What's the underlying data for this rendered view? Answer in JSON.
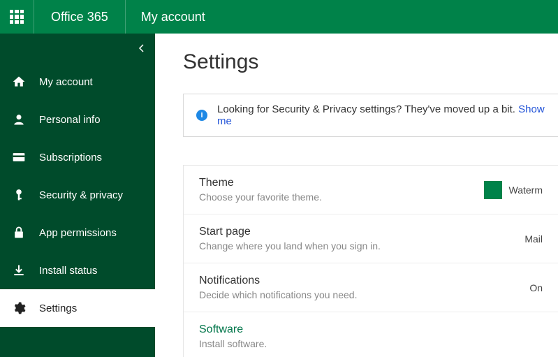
{
  "header": {
    "brand": "Office 365",
    "page": "My account"
  },
  "sidebar": {
    "items": [
      {
        "id": "my-account",
        "label": "My account"
      },
      {
        "id": "personal-info",
        "label": "Personal info"
      },
      {
        "id": "subscriptions",
        "label": "Subscriptions"
      },
      {
        "id": "security-privacy",
        "label": "Security & privacy"
      },
      {
        "id": "app-permissions",
        "label": "App permissions"
      },
      {
        "id": "install-status",
        "label": "Install status"
      },
      {
        "id": "settings",
        "label": "Settings"
      }
    ],
    "active": "settings"
  },
  "page_title": "Settings",
  "notice": {
    "text": "Looking for Security & Privacy settings? They've moved up a bit. ",
    "link_text": "Show me"
  },
  "settings": [
    {
      "title": "Theme",
      "desc": "Choose your favorite theme.",
      "value": "Waterm",
      "swatch": "#008249",
      "link": false
    },
    {
      "title": "Start page",
      "desc": "Change where you land when you sign in.",
      "value": "Mail",
      "link": false
    },
    {
      "title": "Notifications",
      "desc": "Decide which notifications you need.",
      "value": "On",
      "link": false
    },
    {
      "title": "Software",
      "desc": "Install software.",
      "value": "",
      "link": true
    }
  ]
}
